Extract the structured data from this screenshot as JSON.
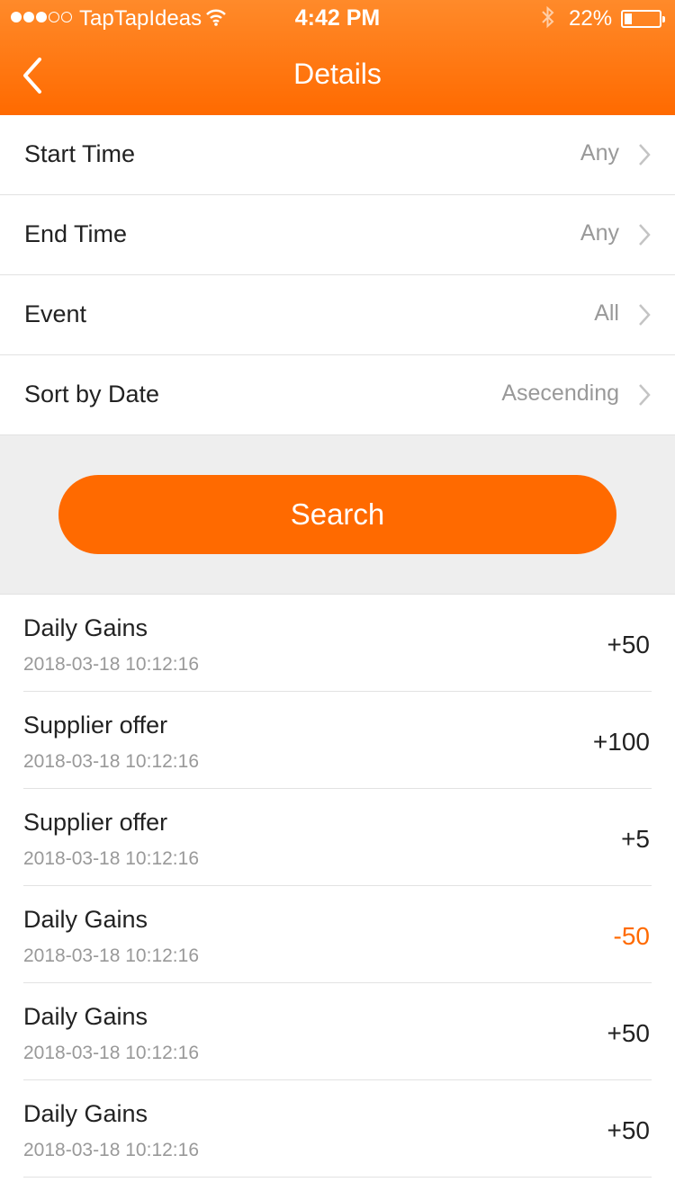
{
  "status_bar": {
    "carrier": "TapTapIdeas",
    "time": "4:42 PM",
    "battery": "22%",
    "battery_level": 0.22
  },
  "nav": {
    "title": "Details"
  },
  "filters": [
    {
      "label": "Start Time",
      "value": "Any"
    },
    {
      "label": "End Time",
      "value": "Any"
    },
    {
      "label": "Event",
      "value": "All"
    },
    {
      "label": "Sort by Date",
      "value": "Asecending"
    }
  ],
  "search_button": "Search",
  "transactions": [
    {
      "title": "Daily Gains",
      "date": "2018-03-18 10:12:16",
      "amount": "+50"
    },
    {
      "title": "Supplier offer",
      "date": "2018-03-18 10:12:16",
      "amount": "+100"
    },
    {
      "title": "Supplier offer",
      "date": "2018-03-18 10:12:16",
      "amount": "+5"
    },
    {
      "title": "Daily Gains",
      "date": "2018-03-18 10:12:16",
      "amount": "-50"
    },
    {
      "title": "Daily Gains",
      "date": "2018-03-18 10:12:16",
      "amount": "+50"
    },
    {
      "title": "Daily Gains",
      "date": "2018-03-18 10:12:16",
      "amount": "+50"
    }
  ],
  "colors": {
    "accent": "#ff6a00",
    "header_top": "#ff8a2a",
    "muted_text": "#999999"
  }
}
